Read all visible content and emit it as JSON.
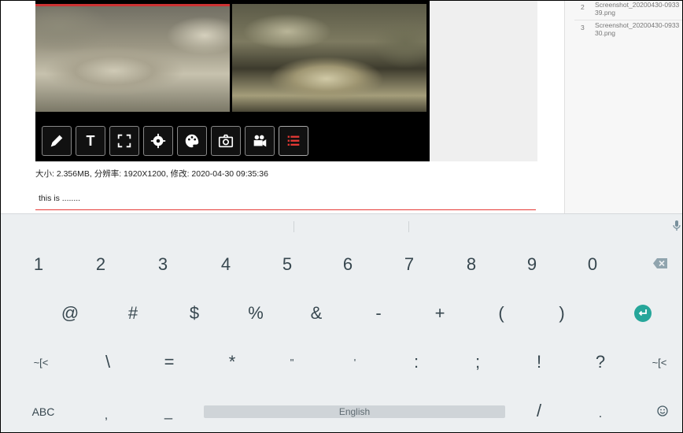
{
  "file_list": [
    {
      "num": "2",
      "name_line1": "Screenshot_20200430-0933",
      "name_line2": "39.png"
    },
    {
      "num": "3",
      "name_line1": "Screenshot_20200430-0933",
      "name_line2": "30.png"
    }
  ],
  "toolbar": {
    "icons": [
      "pencil-icon",
      "text-icon",
      "fullscreen-icon",
      "settings-icon",
      "palette-icon",
      "camera-icon",
      "video-icon",
      "list-icon"
    ],
    "text_label": "T"
  },
  "image_info": "大小: 2.356MB, 分辨率: 1920X1200, 修改: 2020-04-30 09:35:36",
  "note_input": {
    "value": "this is ........"
  },
  "keyboard": {
    "row1": [
      "1",
      "2",
      "3",
      "4",
      "5",
      "6",
      "7",
      "8",
      "9",
      "0"
    ],
    "row2": [
      "@",
      "#",
      "$",
      "%",
      "&",
      "-",
      "+",
      "(",
      ")"
    ],
    "row3": [
      "~[<",
      "\\",
      "=",
      "*",
      "\"",
      "'",
      ":",
      ";",
      "!",
      "?",
      "~[<"
    ],
    "abc_label": "ABC",
    "comma": ",",
    "underscore": "_",
    "space_label": "English",
    "slash": "/",
    "period": ".",
    "colors": {
      "accent": "#26a69a",
      "underline": "#e53935"
    }
  }
}
